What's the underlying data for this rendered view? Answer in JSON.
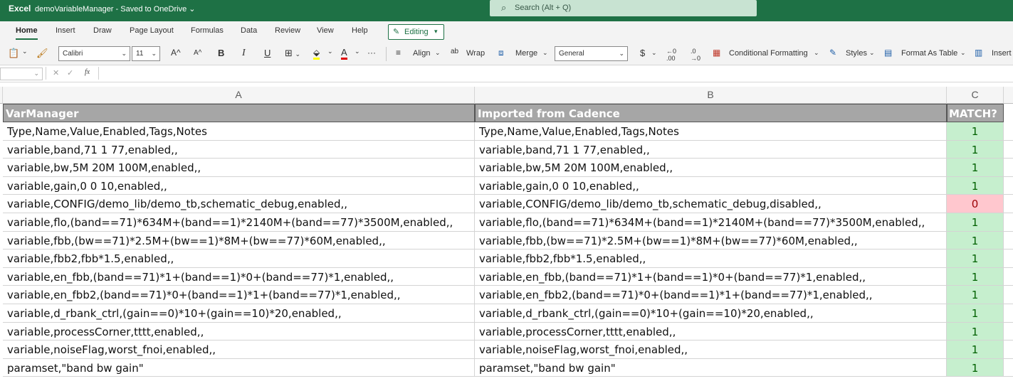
{
  "titlebar": {
    "app": "Excel",
    "document": "demoVariableManager",
    "save_status": " -  Saved to OneDrive",
    "search_placeholder": "Search (Alt + Q)"
  },
  "ribbon_tabs": [
    {
      "label": "Home",
      "active": true
    },
    {
      "label": "Insert"
    },
    {
      "label": "Draw"
    },
    {
      "label": "Page Layout"
    },
    {
      "label": "Formulas"
    },
    {
      "label": "Data"
    },
    {
      "label": "Review"
    },
    {
      "label": "View"
    },
    {
      "label": "Help"
    }
  ],
  "editing_mode": "Editing",
  "toolbar": {
    "font_name": "Calibri",
    "font_size": "11",
    "grow": "A^",
    "shrink": "A^",
    "bold": "B",
    "italic": "I",
    "underline": "U",
    "font_color": "A",
    "more": "···",
    "align": "Align",
    "wrap": "Wrap",
    "merge": "Merge",
    "number_format": "General",
    "currency": "$",
    "conditional_formatting": "Conditional Formatting",
    "styles": "Styles",
    "format_as_table": "Format As Table",
    "insert": "Insert"
  },
  "formula_bar": {
    "fx": "fx"
  },
  "columns": [
    {
      "letter": "A"
    },
    {
      "letter": "B"
    },
    {
      "letter": "C"
    }
  ],
  "header_row": [
    "VarManager",
    "Imported from Cadence",
    "MATCH?"
  ],
  "rows": [
    {
      "a": "Type,Name,Value,Enabled,Tags,Notes",
      "b": "Type,Name,Value,Enabled,Tags,Notes",
      "c": "1"
    },
    {
      "a": "variable,band,71 1 77,enabled,,",
      "b": "variable,band,71 1 77,enabled,,",
      "c": "1"
    },
    {
      "a": "variable,bw,5M 20M 100M,enabled,,",
      "b": "variable,bw,5M 20M 100M,enabled,,",
      "c": "1"
    },
    {
      "a": "variable,gain,0 0 10,enabled,,",
      "b": "variable,gain,0 0 10,enabled,,",
      "c": "1"
    },
    {
      "a": "variable,CONFIG/demo_lib/demo_tb,schematic_debug,enabled,,",
      "b": "variable,CONFIG/demo_lib/demo_tb,schematic_debug,disabled,,",
      "c": "0"
    },
    {
      "a": "variable,flo,(band==71)*634M+(band==1)*2140M+(band==77)*3500M,enabled,,",
      "b": "variable,flo,(band==71)*634M+(band==1)*2140M+(band==77)*3500M,enabled,,",
      "c": "1"
    },
    {
      "a": "variable,fbb,(bw==71)*2.5M+(bw==1)*8M+(bw==77)*60M,enabled,,",
      "b": "variable,fbb,(bw==71)*2.5M+(bw==1)*8M+(bw==77)*60M,enabled,,",
      "c": "1"
    },
    {
      "a": "variable,fbb2,fbb*1.5,enabled,,",
      "b": "variable,fbb2,fbb*1.5,enabled,,",
      "c": "1"
    },
    {
      "a": "variable,en_fbb,(band==71)*1+(band==1)*0+(band==77)*1,enabled,,",
      "b": "variable,en_fbb,(band==71)*1+(band==1)*0+(band==77)*1,enabled,,",
      "c": "1"
    },
    {
      "a": "variable,en_fbb2,(band==71)*0+(band==1)*1+(band==77)*1,enabled,,",
      "b": "variable,en_fbb2,(band==71)*0+(band==1)*1+(band==77)*1,enabled,,",
      "c": "1"
    },
    {
      "a": "variable,d_rbank_ctrl,(gain==0)*10+(gain==10)*20,enabled,,",
      "b": "variable,d_rbank_ctrl,(gain==0)*10+(gain==10)*20,enabled,,",
      "c": "1"
    },
    {
      "a": "variable,processCorner,tttt,enabled,,",
      "b": "variable,processCorner,tttt,enabled,,",
      "c": "1"
    },
    {
      "a": "variable,noiseFlag,worst_fnoi,enabled,,",
      "b": "variable,noiseFlag,worst_fnoi,enabled,,",
      "c": "1"
    },
    {
      "a": "paramset,\"band bw gain\"",
      "b": "paramset,\"band bw gain\"",
      "c": "1"
    }
  ],
  "colors": {
    "brand": "#1e7145",
    "header_fill": "#a6a6a6",
    "match_true_fill": "#c6efce",
    "match_true_text": "#006100",
    "match_false_fill": "#ffc7ce",
    "match_false_text": "#9c0006"
  }
}
